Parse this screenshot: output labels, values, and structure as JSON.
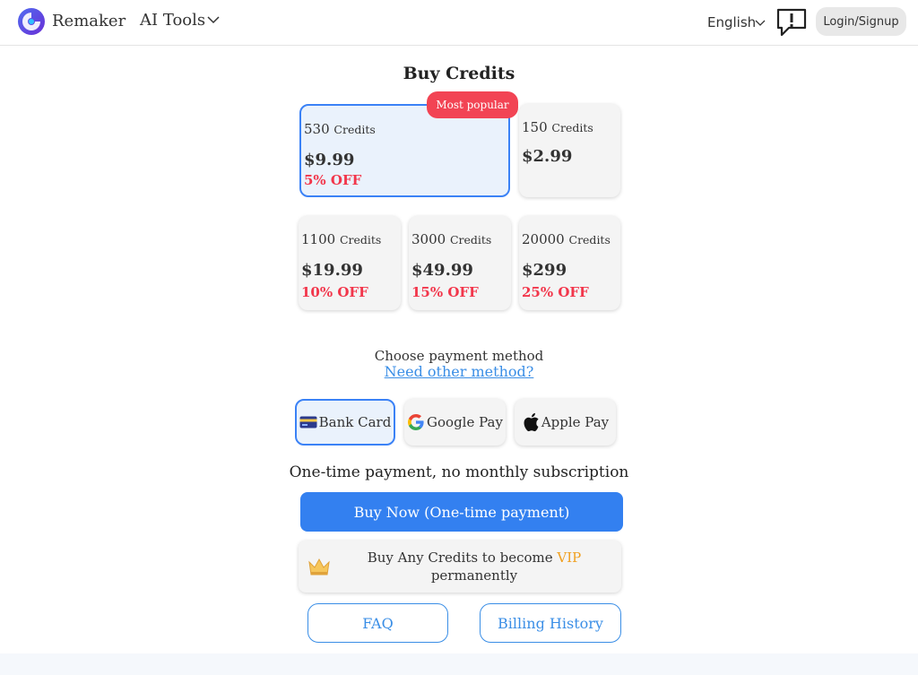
{
  "header": {
    "brand": "Remaker",
    "ai_tools_label": "AI Tools",
    "language": "English",
    "login_label": "Login/Signup"
  },
  "page_title": "Buy Credits",
  "plans": [
    {
      "credits": "530",
      "unit": "Credits",
      "price": "$9.99",
      "discount": "5% OFF",
      "badge": "Most popular",
      "selected": true
    },
    {
      "credits": "150",
      "unit": "Credits",
      "price": "$2.99",
      "discount": ""
    },
    {
      "credits": "1100",
      "unit": "Credits",
      "price": "$19.99",
      "discount": "10% OFF"
    },
    {
      "credits": "3000",
      "unit": "Credits",
      "price": "$49.99",
      "discount": "15% OFF"
    },
    {
      "credits": "20000",
      "unit": "Credits",
      "price": "$299",
      "discount": "25% OFF"
    }
  ],
  "payment": {
    "title": "Choose payment method",
    "other_link": "Need other method?",
    "methods": [
      {
        "label": "Bank Card",
        "icon": "bank-card-icon",
        "selected": true
      },
      {
        "label": "Google Pay",
        "icon": "google-icon"
      },
      {
        "label": "Apple Pay",
        "icon": "apple-icon"
      }
    ]
  },
  "one_time_note": "One-time payment, no monthly subscription",
  "buy_button": "Buy Now (One-time payment)",
  "vip": {
    "text_before": "Buy Any Credits to become ",
    "vip_word": "VIP",
    "text_after": "permanently",
    "icon": "crown-icon"
  },
  "faq_label": "FAQ",
  "billing_label": "Billing History",
  "colors": {
    "accent": "#3380f0",
    "discount": "#f2364b",
    "badge": "#f24454",
    "vip": "#f0a020"
  }
}
